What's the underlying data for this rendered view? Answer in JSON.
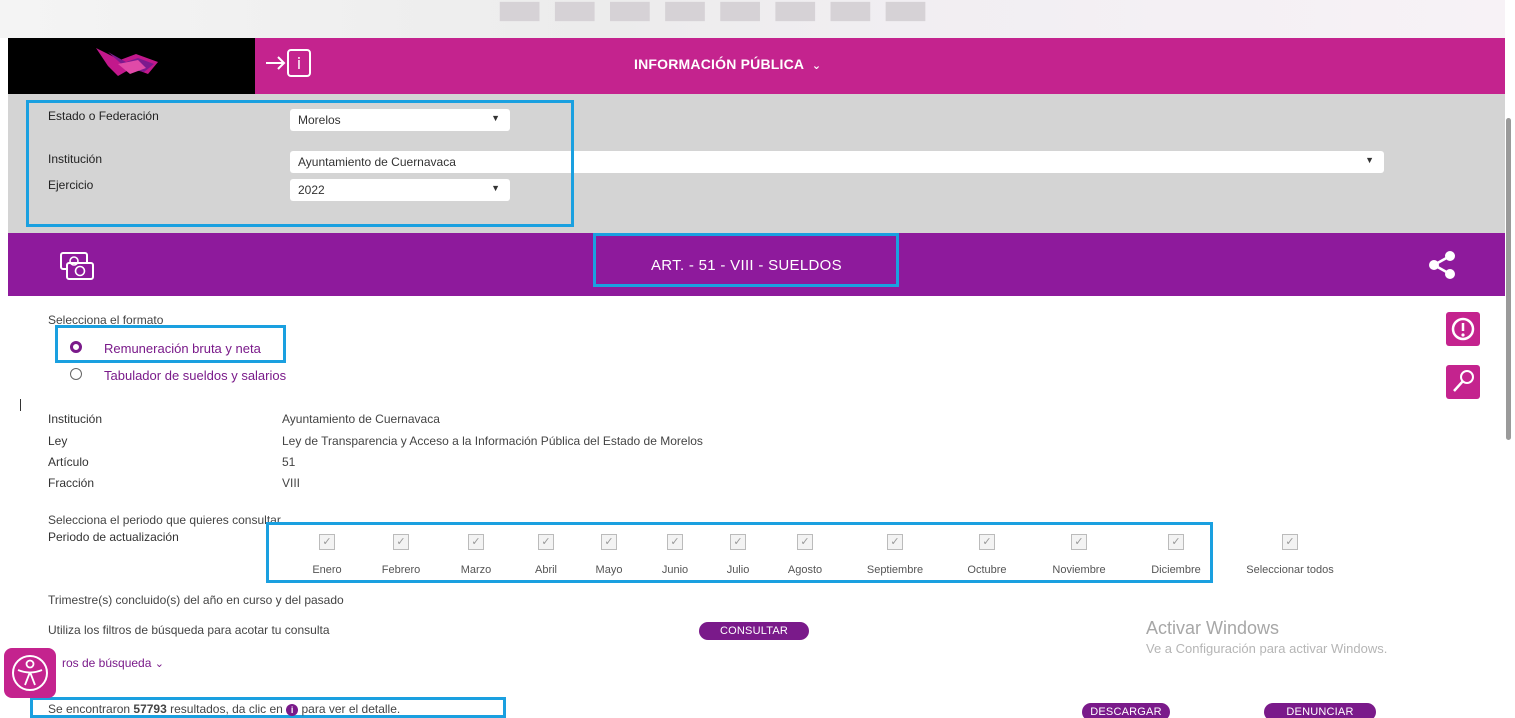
{
  "header": {
    "menu_label": "INFORMACIÓN PÚBLICA",
    "chevron_icon": "chevron-down-icon",
    "login_icon": "login-info-icon"
  },
  "filters": {
    "estado_label": "Estado o Federación",
    "estado_value": "Morelos",
    "institucion_label": "Institución",
    "institucion_value": "Ayuntamiento de Cuernavaca",
    "ejercicio_label": "Ejercicio",
    "ejercicio_value": "2022"
  },
  "section": {
    "title": "ART. - 51 - VIII - SUELDOS",
    "icon": "money-icon",
    "share_icon": "share-icon"
  },
  "formato": {
    "prompt": "Selecciona el formato",
    "options": [
      {
        "label": "Remuneración bruta y neta",
        "selected": true
      },
      {
        "label": "Tabulador de sueldos y salarios",
        "selected": false
      }
    ]
  },
  "details": [
    {
      "label": "Institución",
      "value": "Ayuntamiento de Cuernavaca"
    },
    {
      "label": "Ley",
      "value": "Ley de Transparencia y Acceso a la Información Pública del Estado de Morelos"
    },
    {
      "label": "Artículo",
      "value": "51"
    },
    {
      "label": "Fracción",
      "value": "VIII"
    }
  ],
  "periodo": {
    "prompt": "Selecciona el periodo que quieres consultar",
    "label": "Periodo de actualización",
    "months": [
      "Enero",
      "Febrero",
      "Marzo",
      "Abril",
      "Mayo",
      "Junio",
      "Julio",
      "Agosto",
      "Septiembre",
      "Octubre",
      "Noviembre",
      "Diciembre"
    ],
    "select_all": "Seleccionar todos"
  },
  "trimestre_text": "Trimestre(s) concluido(s) del año en curso y del pasado",
  "filtros_text": "Utiliza los filtros de búsqueda para acotar tu consulta",
  "consultar_label": "CONSULTAR",
  "filtros_toggle": "ros de búsqueda",
  "results": {
    "prefix": "Se encontraron ",
    "count": "57793",
    "middle": " resultados, da clic en ",
    "suffix": " para ver el detalle."
  },
  "descargar_label": "DESCARGAR",
  "denunciar_label": "DENUNCIAR",
  "watermark": {
    "line1": "Activar Windows",
    "line2": "Ve a Configuración para activar Windows."
  },
  "colors": {
    "magenta": "#c4238e",
    "purple": "#8e1a9c",
    "highlight": "#1aa0e0"
  }
}
